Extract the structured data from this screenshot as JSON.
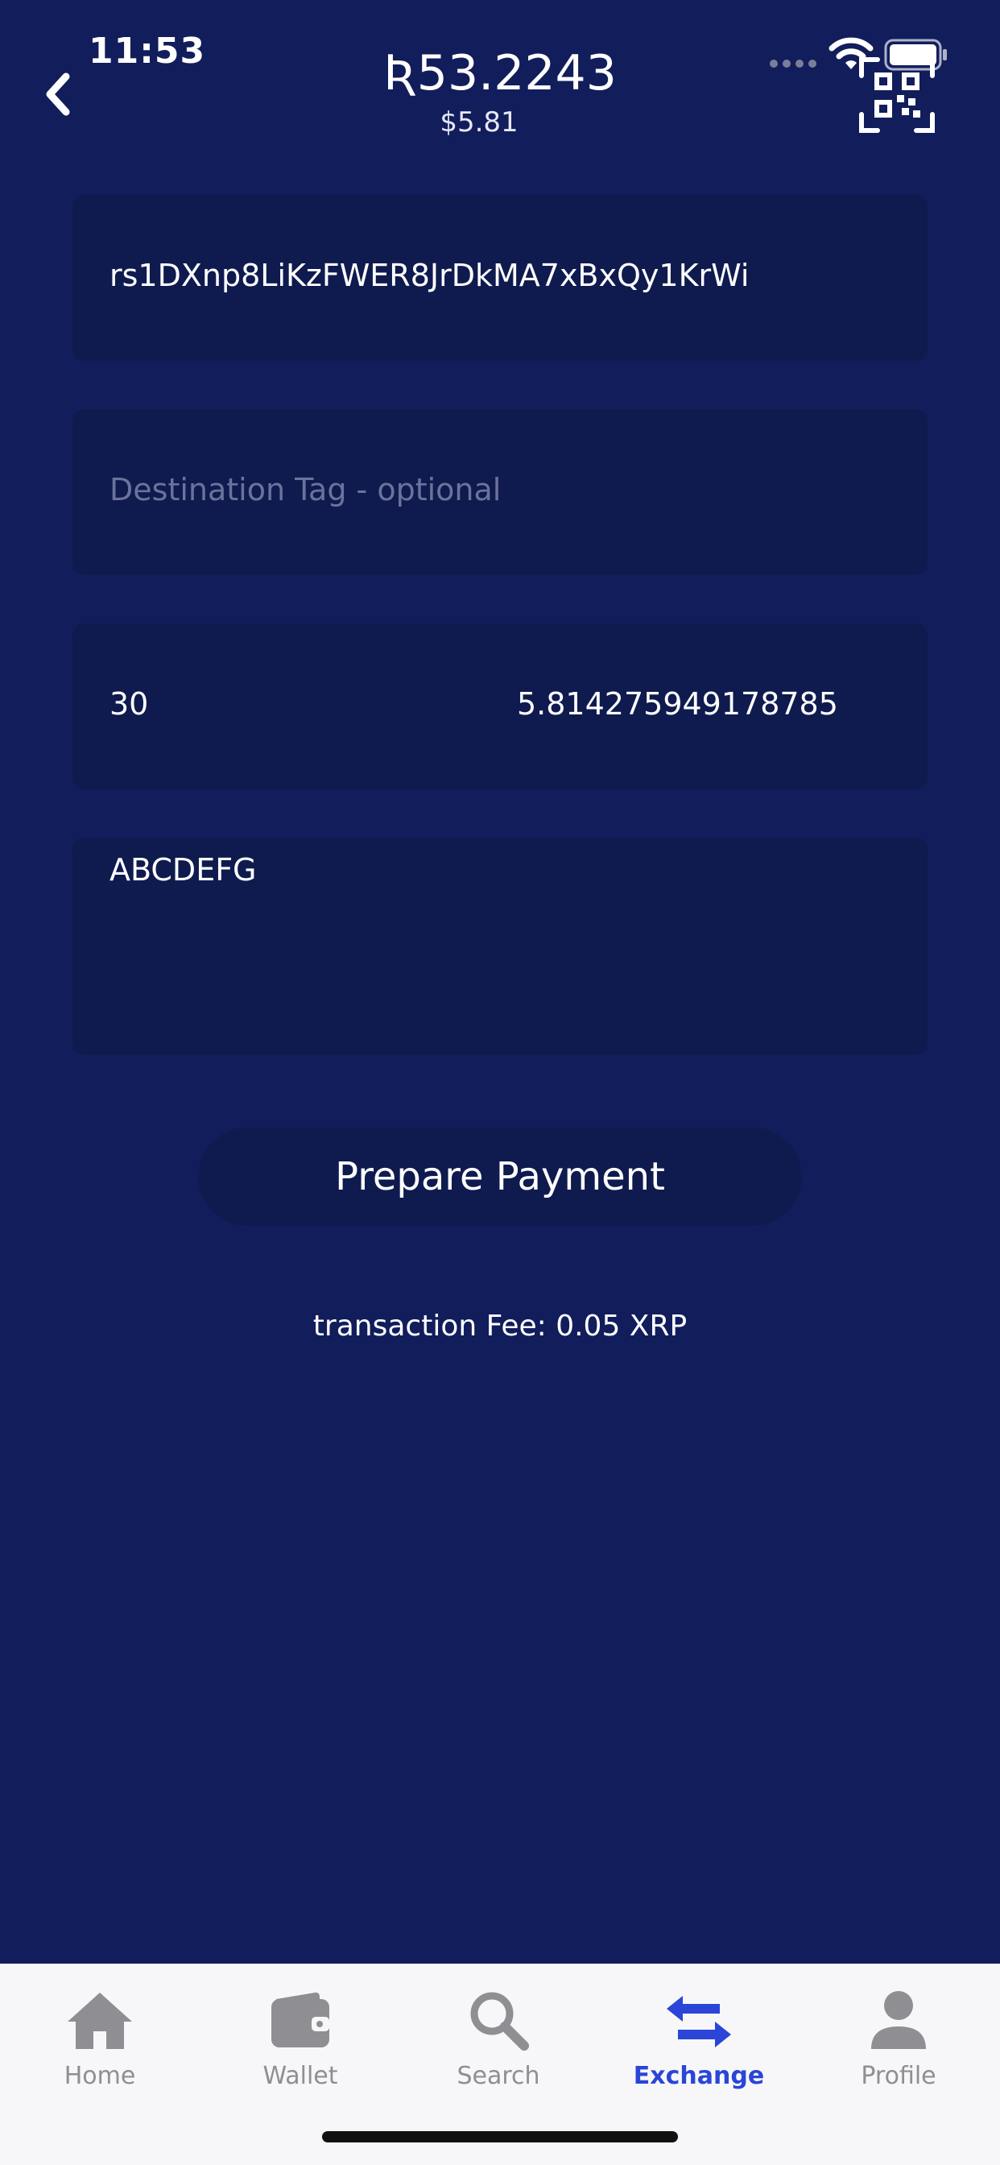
{
  "status_bar": {
    "time": "11:53"
  },
  "header": {
    "balance": "Ʀ53.2243",
    "fiat_value": "$5.81"
  },
  "form": {
    "address_value": "rs1DXnp8LiKzFWER8JrDkMA7xBxQy1KrWi",
    "destination_tag_placeholder": "Destination Tag - optional",
    "amount_value": "30",
    "amount_converted": "5.814275949178785",
    "memo_value": "ABCDEFG",
    "prepare_label": "Prepare Payment",
    "fee_text": "transaction Fee: 0.05 XRP"
  },
  "tab_bar": {
    "tabs": [
      {
        "label": "Home",
        "icon": "home-icon"
      },
      {
        "label": "Wallet",
        "icon": "wallet-icon"
      },
      {
        "label": "Search",
        "icon": "search-icon"
      },
      {
        "label": "Exchange",
        "icon": "exchange-icon",
        "active": true
      },
      {
        "label": "Profile",
        "icon": "profile-icon"
      }
    ]
  },
  "colors": {
    "background": "#121d5c",
    "field": "#0f1b4f",
    "active_tab": "#2a45d8",
    "inactive_tab": "#8e8e93"
  }
}
